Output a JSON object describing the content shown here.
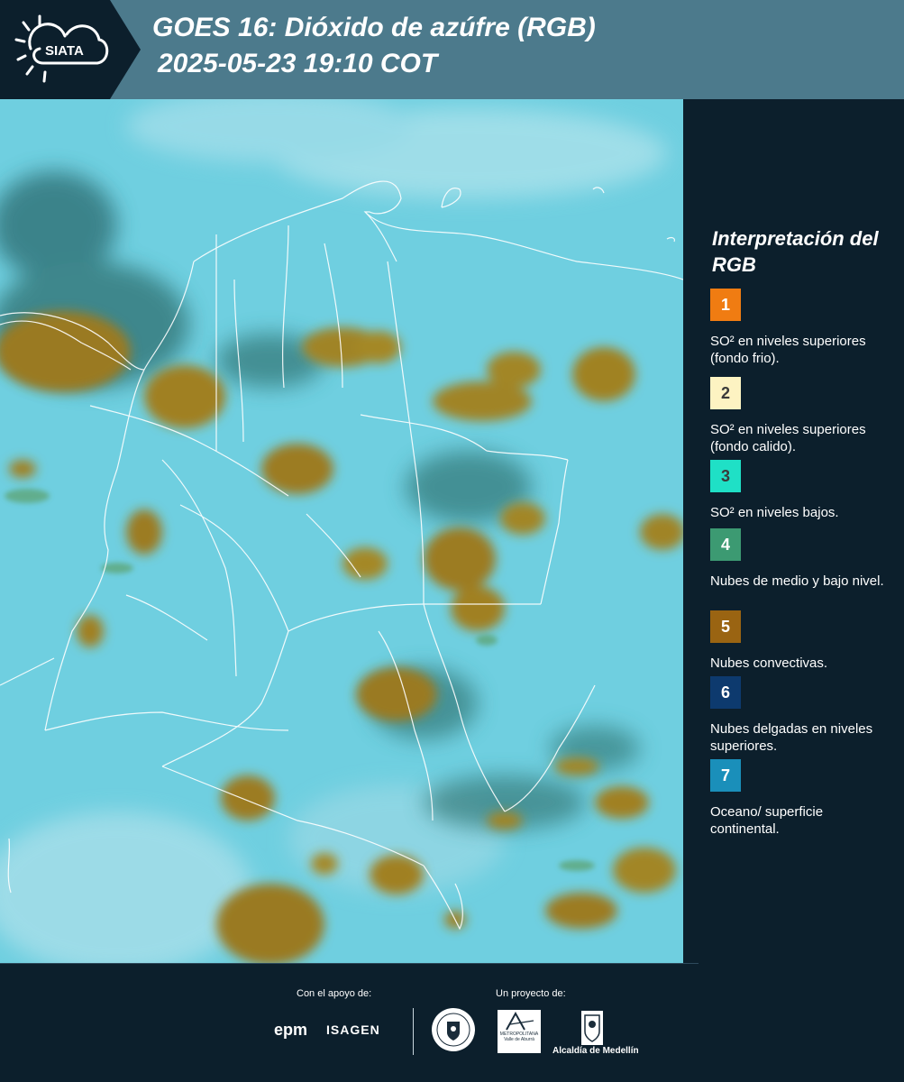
{
  "header": {
    "logo_text": "SIATA",
    "title_line1": "GOES 16: Dióxido de azúfre (RGB)",
    "title_line2": "2025-05-23 19:10 COT"
  },
  "legend": {
    "title": "Interpretación del RGB",
    "items": [
      {
        "number": "1",
        "color": "#f07c12",
        "label": "SO² en niveles superiores (fondo frio)."
      },
      {
        "number": "2",
        "color": "#fdf3c2",
        "label": "SO² en niveles superiores (fondo calido)."
      },
      {
        "number": "3",
        "color": "#1fe0c6",
        "label": "SO² en niveles bajos."
      },
      {
        "number": "4",
        "color": "#3c9a72",
        "label": "Nubes de medio y bajo nivel."
      },
      {
        "number": "5",
        "color": "#9a6412",
        "label": "Nubes convectivas."
      },
      {
        "number": "6",
        "color": "#0d3a6e",
        "label": "Nubes delgadas en niveles superiores."
      },
      {
        "number": "7",
        "color": "#1a8fba",
        "label": "Oceano/ superficie continental."
      }
    ]
  },
  "footer": {
    "support_label": "Con el apoyo de:",
    "project_label": "Un proyecto de:",
    "sponsors": [
      "epm",
      "ISAGEN"
    ],
    "amva_name": "METROPOLITANA Valle de Aburrá",
    "alcaldia_name": "Alcaldía de Medellín"
  },
  "colors": {
    "header_bg": "#4c7a8c",
    "panel_bg": "#0c1f2c",
    "map_bg": "#6fcfe0",
    "cloud_convective": "#9a7a20",
    "cloud_mid": "#2e7a7c"
  }
}
